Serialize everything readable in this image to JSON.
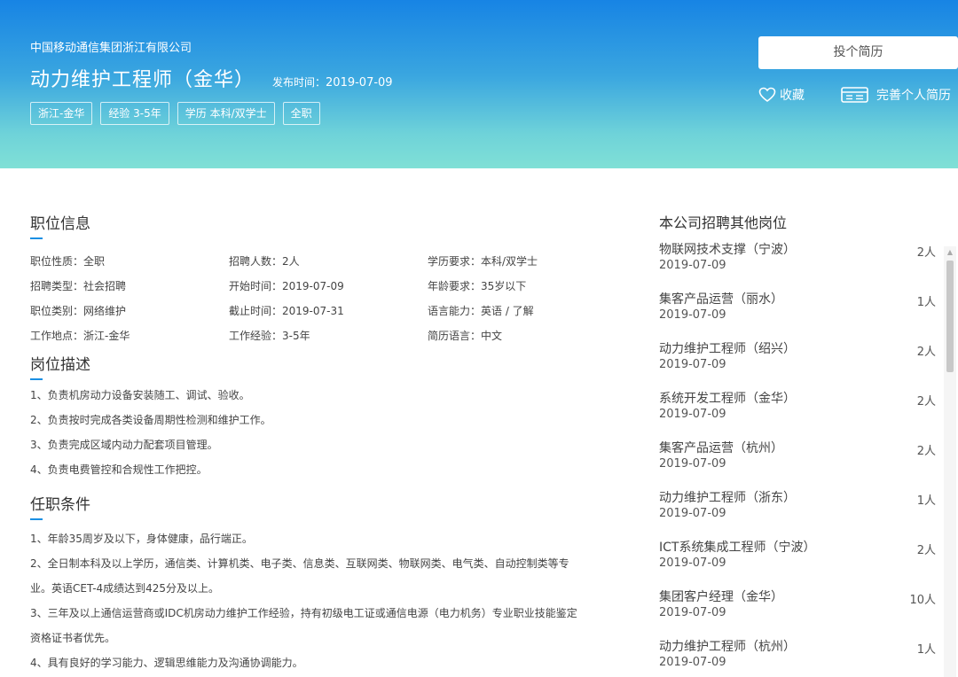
{
  "header": {
    "company": "中国移动通信集团浙江有限公司",
    "job_title": "动力维护工程师（金华）",
    "publish_label": "发布时间：",
    "publish_date": "2019-07-09",
    "tags": [
      "浙江-金华",
      "经验 3-5年",
      "学历 本科/双学士",
      "全职"
    ],
    "apply_label": "投个简历",
    "favorite_label": "收藏",
    "resume_label": "完善个人简历"
  },
  "job_info": {
    "title": "职位信息",
    "rows": [
      [
        "职位性质：全职",
        "招聘人数：2人",
        "学历要求：本科/双学士"
      ],
      [
        "招聘类型：社会招聘",
        "开始时间：2019-07-09",
        "年龄要求：35岁以下"
      ],
      [
        "职位类别：网络维护",
        "截止时间：2019-07-31",
        "语言能力：英语 / 了解"
      ],
      [
        "工作地点：浙江-金华",
        "工作经验：3-5年",
        "简历语言：中文"
      ]
    ]
  },
  "description": {
    "title": "岗位描述",
    "lines": [
      "1、负责机房动力设备安装随工、调试、验收。",
      "2、负责按时完成各类设备周期性检测和维护工作。",
      "3、负责完成区域内动力配套项目管理。",
      "4、负责电费管控和合规性工作把控。"
    ]
  },
  "requirements": {
    "title": "任职条件",
    "lines": [
      "1、年龄35周岁及以下，身体健康，品行端正。",
      "2、全日制本科及以上学历，通信类、计算机类、电子类、信息类、互联网类、物联网类、电气类、自动控制类等专",
      "业。英语CET-4成绩达到425分及以上。",
      "3、三年及以上通信运营商或IDC机房动力维护工作经验，持有初级电工证或通信电源（电力机务）专业职业技能鉴定",
      "资格证书者优先。",
      "4、具有良好的学习能力、逻辑思维能力及沟通协调能力。"
    ]
  },
  "sidebar": {
    "title": "本公司招聘其他岗位",
    "items": [
      {
        "name": "物联网技术支撑（宁波）",
        "date": "2019-07-09",
        "count": "2人"
      },
      {
        "name": "集客产品运营（丽水）",
        "date": "2019-07-09",
        "count": "1人"
      },
      {
        "name": "动力维护工程师（绍兴）",
        "date": "2019-07-09",
        "count": "2人"
      },
      {
        "name": "系统开发工程师（金华）",
        "date": "2019-07-09",
        "count": "2人"
      },
      {
        "name": "集客产品运营（杭州）",
        "date": "2019-07-09",
        "count": "2人"
      },
      {
        "name": "动力维护工程师（浙东）",
        "date": "2019-07-09",
        "count": "1人"
      },
      {
        "name": "ICT系统集成工程师（宁波）",
        "date": "2019-07-09",
        "count": "2人"
      },
      {
        "name": "集团客户经理（金华）",
        "date": "2019-07-09",
        "count": "10人"
      },
      {
        "name": "动力维护工程师（杭州）",
        "date": "2019-07-09",
        "count": "1人"
      }
    ]
  },
  "icons": {
    "favorite": "heart-icon",
    "resume": "resume-card-icon",
    "scroll_up": "chevron-up-icon"
  }
}
